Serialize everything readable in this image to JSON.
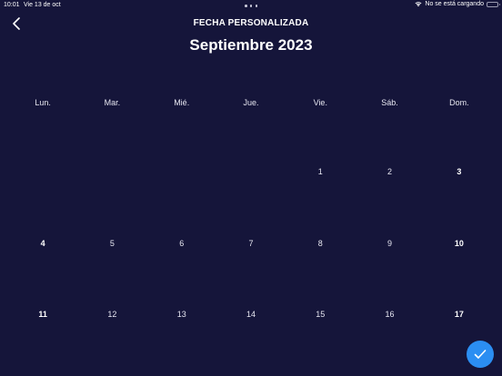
{
  "status_bar": {
    "time": "10:01",
    "date": "Vie 13 de oct",
    "charging": "No se está cargando"
  },
  "header": {
    "title": "FECHA PERSONALIZADA",
    "back_icon": "chevron-left-icon"
  },
  "calendar": {
    "month_title": "Septiembre 2023",
    "weekdays": [
      "Lun.",
      "Mar.",
      "Mié.",
      "Jue.",
      "Vie.",
      "Sáb.",
      "Dom."
    ],
    "weeks": [
      [
        "",
        "",
        "",
        "",
        "1",
        "2",
        "3"
      ],
      [
        "4",
        "5",
        "6",
        "7",
        "8",
        "9",
        "10"
      ],
      [
        "11",
        "12",
        "13",
        "14",
        "15",
        "16",
        "17"
      ]
    ]
  },
  "confirm": {
    "icon": "checkmark-icon"
  },
  "colors": {
    "background": "#15153a",
    "accent": "#2b8ef2",
    "text": "#ffffff"
  }
}
